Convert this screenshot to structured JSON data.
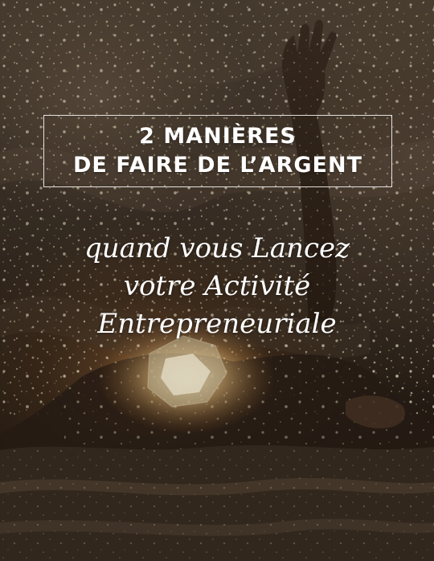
{
  "title": {
    "line1": "2 MANIÈRES",
    "line2": "DE FAIRE DE L’ARGENT"
  },
  "subtitle": {
    "line1": "quand vous Lancez",
    "line2": "votre Activité",
    "line3": "Entrepreneuriale"
  },
  "colors": {
    "text": "#ffffff",
    "background_dark": "#1a140d",
    "lamp_glow": "#ffe4aa"
  }
}
